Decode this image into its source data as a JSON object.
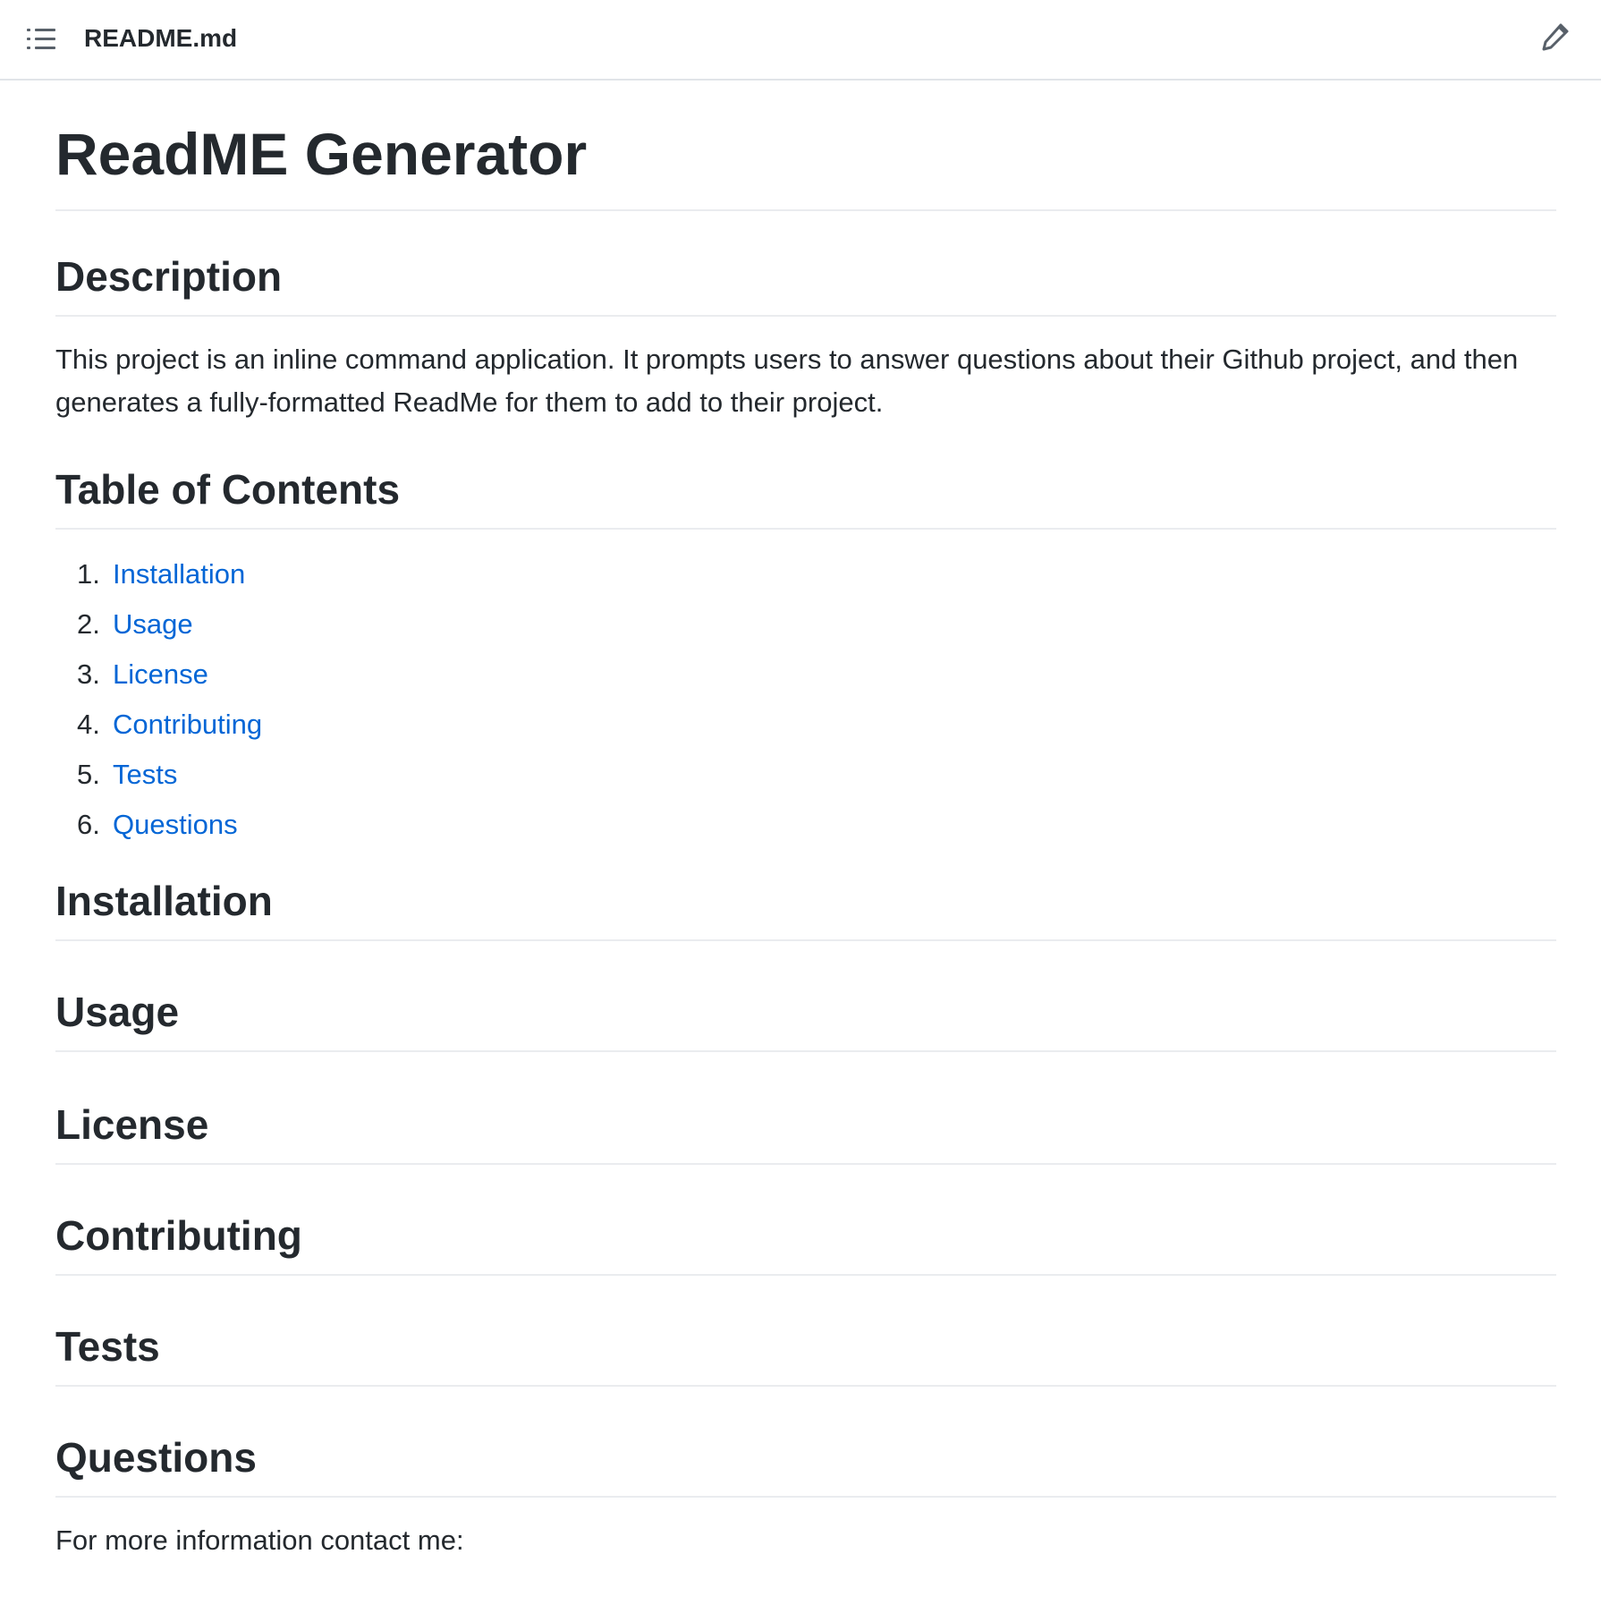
{
  "header": {
    "filename": "README.md",
    "toc_icon": "list-unordered-icon",
    "edit_icon": "pencil-icon"
  },
  "doc": {
    "title": "ReadME Generator",
    "description_heading": "Description",
    "description_text": "This project is an inline command application. It prompts users to answer questions about their Github project, and then generates a fully-formatted ReadMe for them to add to their project.",
    "toc_heading": "Table of Contents",
    "toc_items": [
      {
        "num": "1.",
        "label": "Installation"
      },
      {
        "num": "2.",
        "label": "Usage"
      },
      {
        "num": "3.",
        "label": "License"
      },
      {
        "num": "4.",
        "label": "Contributing"
      },
      {
        "num": "5.",
        "label": "Tests"
      },
      {
        "num": "6.",
        "label": "Questions"
      }
    ],
    "installation_heading": "Installation",
    "usage_heading": "Usage",
    "license_heading": "License",
    "contributing_heading": "Contributing",
    "tests_heading": "Tests",
    "questions_heading": "Questions",
    "questions_text": "For more information contact me:"
  },
  "colors": {
    "text": "#24292e",
    "link": "#0366d6",
    "border": "#eaecef",
    "icon": "#586069"
  }
}
